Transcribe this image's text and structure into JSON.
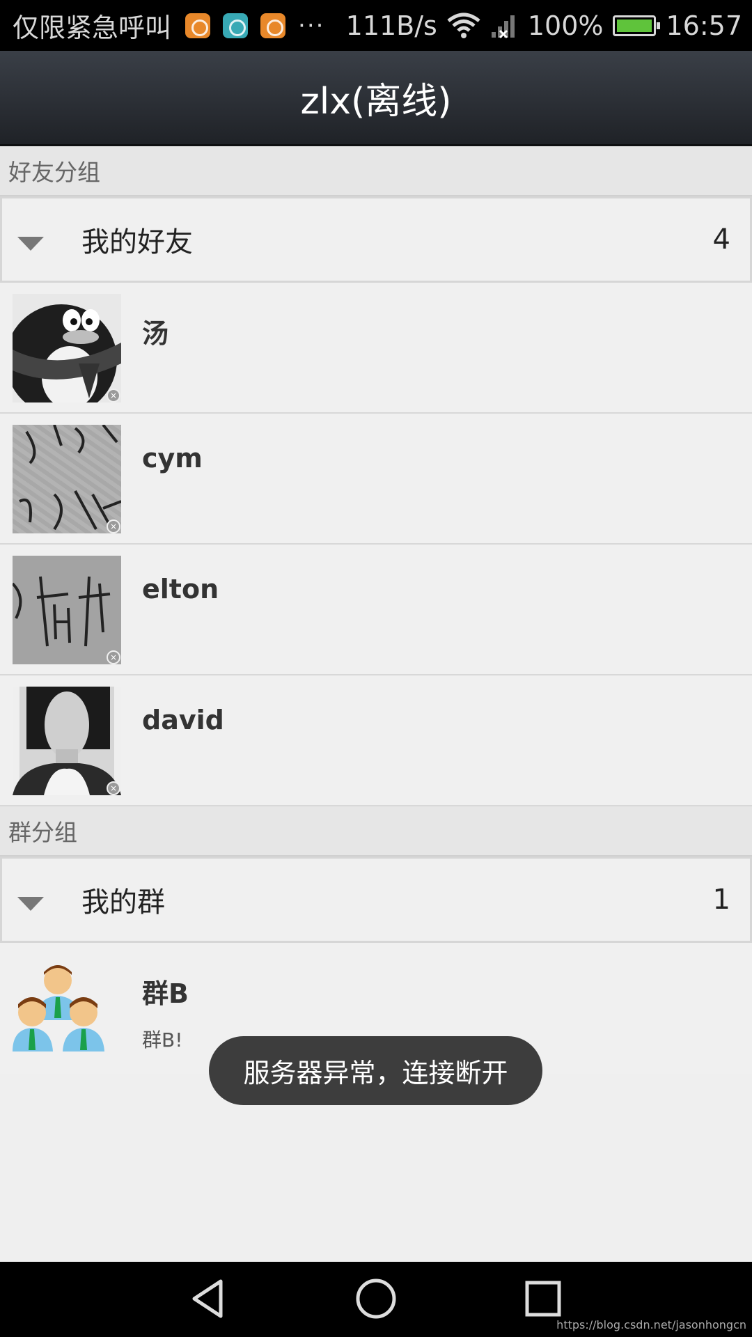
{
  "status_bar": {
    "carrier": "仅限紧急呼叫",
    "more": "···",
    "net_speed": "111B/s",
    "battery": "100%",
    "time": "16:57",
    "icons": [
      "uc-browser-icon",
      "android-icon",
      "uc-browser-icon",
      "wifi-icon",
      "signal-icon",
      "battery-icon"
    ]
  },
  "header": {
    "title": "zlx(离线)"
  },
  "sections": {
    "friends": {
      "label": "好友分组",
      "group": {
        "name": "我的好友",
        "count": "4"
      },
      "items": [
        {
          "name": "汤"
        },
        {
          "name": "cym"
        },
        {
          "name": "elton"
        },
        {
          "name": "david"
        }
      ]
    },
    "groups": {
      "label": "群分组",
      "group": {
        "name": "我的群",
        "count": "1"
      },
      "items": [
        {
          "name": "群B",
          "subtitle": "群B!"
        }
      ]
    }
  },
  "toast": {
    "text": "服务器异常，连接断开"
  },
  "nav": {
    "back": "back-icon",
    "home": "home-icon",
    "recent": "recent-apps-icon"
  },
  "watermark": "https://blog.csdn.net/jasonhongcn",
  "colors": {
    "title_bar": "#2b2f35",
    "background": "#efefef",
    "battery": "#5fc33b",
    "toast": "#3d3d3d"
  }
}
